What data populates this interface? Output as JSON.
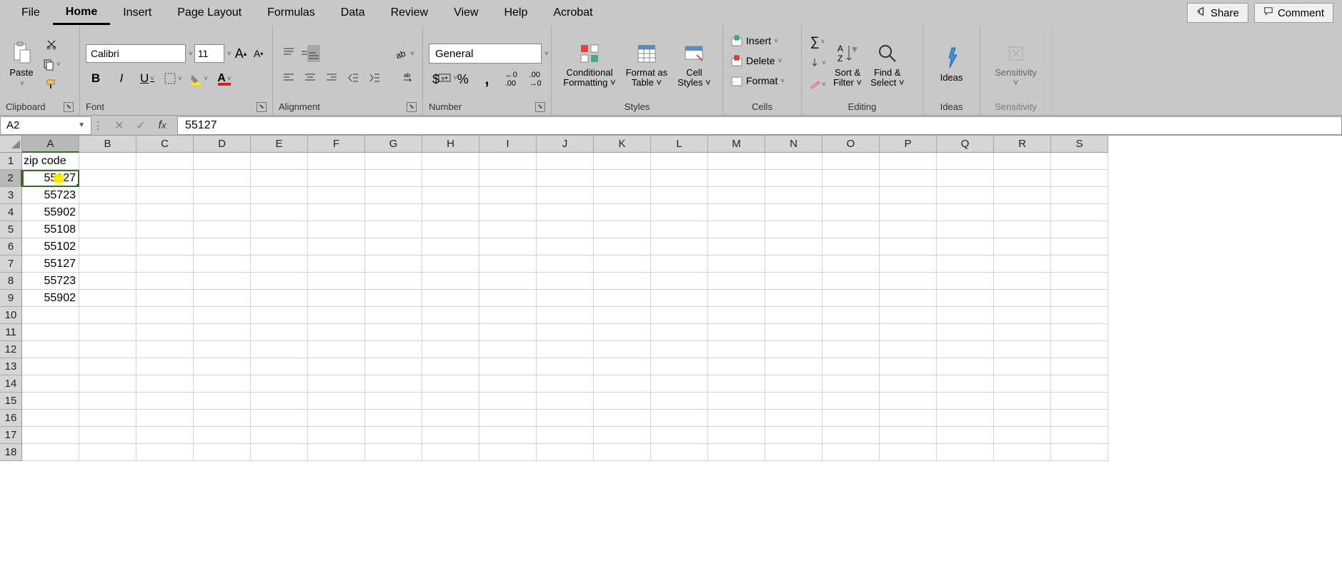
{
  "menu": [
    "File",
    "Home",
    "Insert",
    "Page Layout",
    "Formulas",
    "Data",
    "Review",
    "View",
    "Help",
    "Acrobat"
  ],
  "active_menu": "Home",
  "top_buttons": {
    "share": "Share",
    "comment": "Comment"
  },
  "ribbon": {
    "clipboard": {
      "paste": "Paste",
      "label": "Clipboard"
    },
    "font": {
      "name": "Calibri",
      "size": "11",
      "label": "Font"
    },
    "alignment": {
      "label": "Alignment"
    },
    "number": {
      "format": "General",
      "label": "Number"
    },
    "styles": {
      "cond": "Conditional Formatting",
      "table": "Format as Table",
      "cell": "Cell Styles",
      "label": "Styles"
    },
    "cells": {
      "insert": "Insert",
      "delete": "Delete",
      "format": "Format",
      "label": "Cells"
    },
    "editing": {
      "sort": "Sort & Filter",
      "find": "Find & Select",
      "label": "Editing"
    },
    "ideas": {
      "ideas": "Ideas",
      "label": "Ideas"
    },
    "sensitivity": {
      "sens": "Sensitivity",
      "label": "Sensitivity"
    }
  },
  "namebox": "A2",
  "formula": "55127",
  "columns": [
    "A",
    "B",
    "C",
    "D",
    "E",
    "F",
    "G",
    "H",
    "I",
    "J",
    "K",
    "L",
    "M",
    "N",
    "O",
    "P",
    "Q",
    "R",
    "S"
  ],
  "active_col": "A",
  "rows": [
    "1",
    "2",
    "3",
    "4",
    "5",
    "6",
    "7",
    "8",
    "9",
    "10",
    "11",
    "12",
    "13",
    "14",
    "15",
    "16",
    "17",
    "18"
  ],
  "active_row": "2",
  "selected_cell": "A2",
  "data": {
    "A1": {
      "v": "zip code",
      "t": "text"
    },
    "A2": {
      "v": "55127",
      "t": "num"
    },
    "A3": {
      "v": "55723",
      "t": "num"
    },
    "A4": {
      "v": "55902",
      "t": "num"
    },
    "A5": {
      "v": "55108",
      "t": "num"
    },
    "A6": {
      "v": "55102",
      "t": "num"
    },
    "A7": {
      "v": "55127",
      "t": "num"
    },
    "A8": {
      "v": "55723",
      "t": "num"
    },
    "A9": {
      "v": "55902",
      "t": "num"
    }
  }
}
